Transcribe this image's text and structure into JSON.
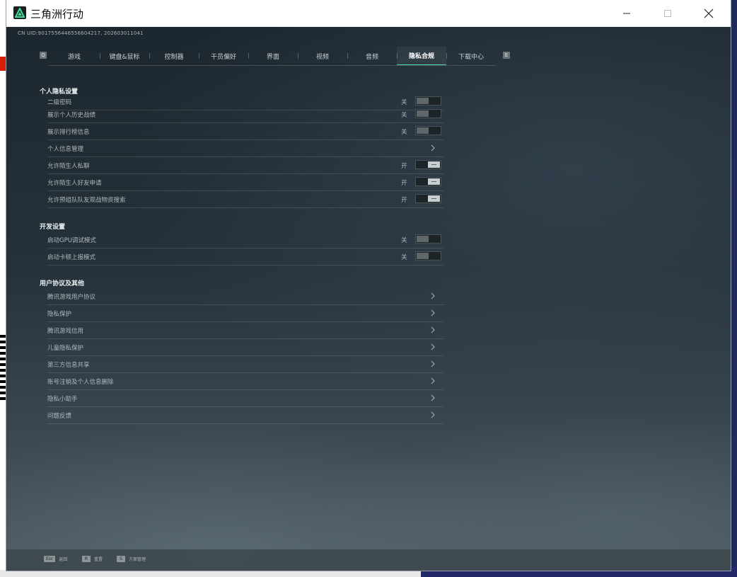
{
  "window": {
    "title": "三角洲行动",
    "controls": {
      "minimize": "minimize",
      "maximize": "maximize",
      "close": "close"
    }
  },
  "uid_text": "CN UID:9017556446556604217, 202603011041",
  "nav": {
    "prev_key": "Q",
    "next_key": "E",
    "tabs": [
      {
        "label": "游戏",
        "active": false
      },
      {
        "label": "键盘&鼠标",
        "active": false
      },
      {
        "label": "控制器",
        "active": false
      },
      {
        "label": "干员偏好",
        "active": false
      },
      {
        "label": "界面",
        "active": false
      },
      {
        "label": "视频",
        "active": false
      },
      {
        "label": "音频",
        "active": false
      },
      {
        "label": "隐私合规",
        "active": true
      },
      {
        "label": "下载中心",
        "active": false
      }
    ]
  },
  "sections": {
    "privacy": {
      "title": "个人隐私设置",
      "rows": [
        {
          "label": "二级密码",
          "state": "关",
          "toggle": "off"
        },
        {
          "label": "展示个人历史战绩",
          "state": "关",
          "toggle": "off"
        },
        {
          "label": "展示排行榜信息",
          "state": "关",
          "toggle": "off"
        },
        {
          "label": "个人信息管理",
          "state": "",
          "toggle": "link"
        },
        {
          "label": "允许陌生人私聊",
          "state": "开",
          "toggle": "on"
        },
        {
          "label": "允许陌生人好友申请",
          "state": "开",
          "toggle": "on"
        },
        {
          "label": "允许预组队队友观战物资搜索",
          "state": "开",
          "toggle": "on"
        }
      ]
    },
    "dev": {
      "title": "开发设置",
      "rows": [
        {
          "label": "启动GPU调试模式",
          "state": "关",
          "toggle": "off"
        },
        {
          "label": "启动卡顿上报模式",
          "state": "关",
          "toggle": "off"
        }
      ]
    },
    "other": {
      "title": "用户协议及其他",
      "rows": [
        {
          "label": "腾讯游戏用户协议"
        },
        {
          "label": "隐私保护"
        },
        {
          "label": "腾讯游戏信用"
        },
        {
          "label": "儿童隐私保护"
        },
        {
          "label": "第三方信息共享"
        },
        {
          "label": "账号注销及个人信息删除"
        },
        {
          "label": "隐私小助手"
        },
        {
          "label": "问题反馈"
        }
      ]
    }
  },
  "bottom_hints": [
    {
      "key": "Esc",
      "label": "返回"
    },
    {
      "key": "R",
      "label": "重置"
    },
    {
      "key": "S",
      "label": "方案管理"
    }
  ],
  "colors": {
    "accent": "#4fd8a8",
    "panel_bg": "#26323b",
    "text": "#aeb7bc"
  }
}
